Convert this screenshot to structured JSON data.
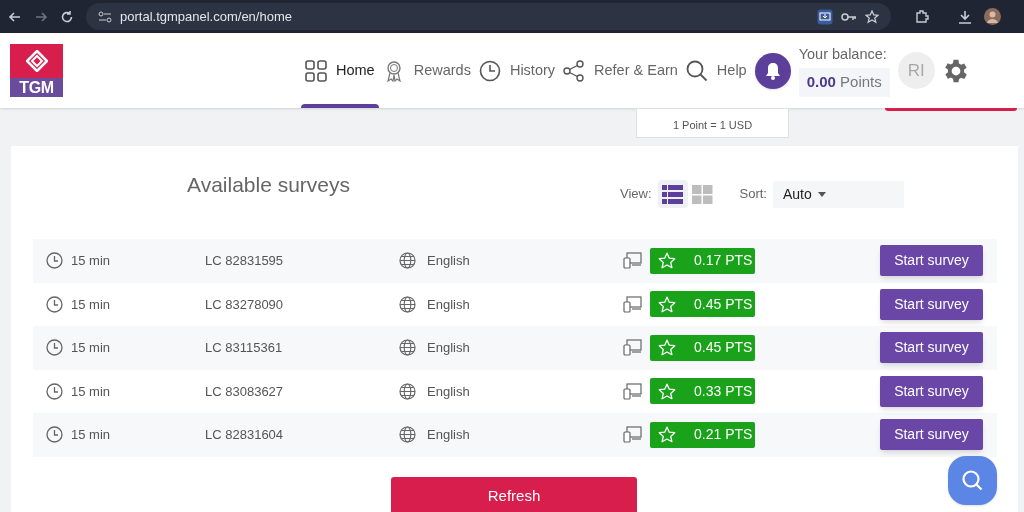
{
  "browser": {
    "url": "portal.tgmpanel.com/en/home"
  },
  "logo": {
    "text": "TGM"
  },
  "nav": [
    {
      "label": "Home",
      "kind": "grid",
      "selected": true
    },
    {
      "label": "Rewards",
      "kind": "award",
      "selected": false
    },
    {
      "label": "History",
      "kind": "clock",
      "selected": false
    },
    {
      "label": "Refer & Earn",
      "kind": "share",
      "selected": false
    },
    {
      "label": "Help",
      "kind": "search",
      "selected": false
    }
  ],
  "balance": {
    "label": "Your balance:",
    "amount": "0.00",
    "unit": "Points"
  },
  "avatar": {
    "initials": "RI"
  },
  "points_note": "1 Point = 1 USD",
  "surveys": {
    "title": "Available surveys",
    "view_label": "View:",
    "views": [
      {
        "kind": "list",
        "selected": true
      },
      {
        "kind": "tiles",
        "selected": false
      }
    ],
    "sort_label": "Sort:",
    "sort_value": "Auto",
    "rows": [
      {
        "duration": "15 min",
        "code": "LC 82831595",
        "language": "English",
        "points": "0.17 PTS",
        "action": "Start survey"
      },
      {
        "duration": "15 min",
        "code": "LC 83278090",
        "language": "English",
        "points": "0.45 PTS",
        "action": "Start survey"
      },
      {
        "duration": "15 min",
        "code": "LC 83115361",
        "language": "English",
        "points": "0.45 PTS",
        "action": "Start survey"
      },
      {
        "duration": "15 min",
        "code": "LC 83083627",
        "language": "English",
        "points": "0.33 PTS",
        "action": "Start survey"
      },
      {
        "duration": "15 min",
        "code": "LC 82831604",
        "language": "English",
        "points": "0.21 PTS",
        "action": "Start survey"
      }
    ],
    "refresh": "Refresh"
  }
}
